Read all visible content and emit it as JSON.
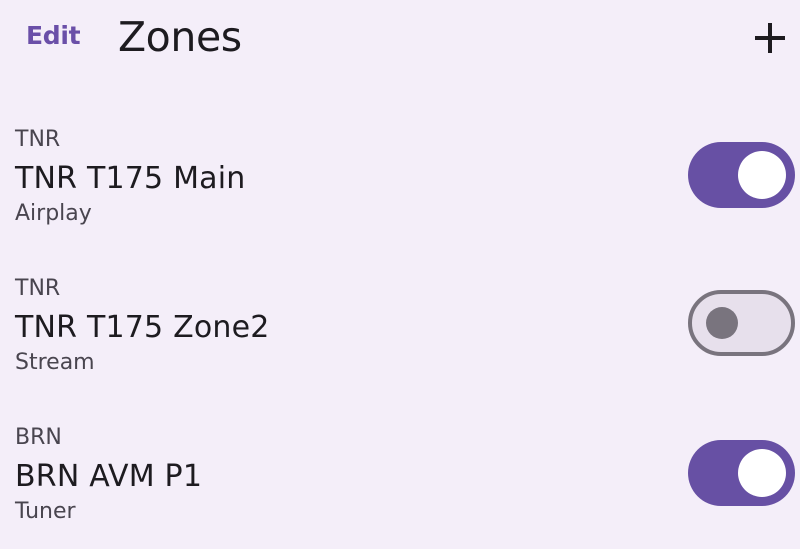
{
  "header": {
    "edit_label": "Edit",
    "title": "Zones",
    "add_icon": "plus-icon"
  },
  "zones": [
    {
      "device": "TNR",
      "name": "TNR T175 Main",
      "source": "Airplay",
      "enabled": true
    },
    {
      "device": "TNR",
      "name": "TNR T175 Zone2",
      "source": "Stream",
      "enabled": false
    },
    {
      "device": "BRN",
      "name": "BRN AVM P1",
      "source": "Tuner",
      "enabled": true
    }
  ],
  "colors": {
    "accent": "#6750a4",
    "background": "#f4eef9",
    "toggle_off_track": "#e7e0ec",
    "toggle_off_outline": "#79747e"
  }
}
